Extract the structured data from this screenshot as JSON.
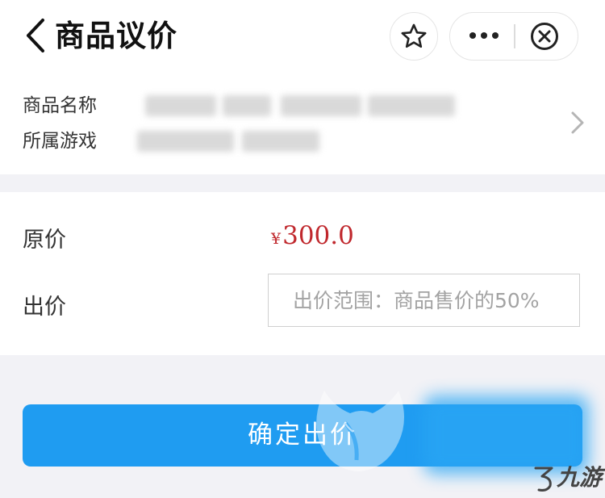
{
  "header": {
    "title": "商品议价"
  },
  "product": {
    "name_label": "商品名称",
    "game_label": "所属游戏"
  },
  "price": {
    "original_label": "原价",
    "currency_symbol": "¥",
    "original_value": "300.0",
    "offer_label": "出价",
    "offer_placeholder": "出价范围：商品售价的50%",
    "offer_value": ""
  },
  "confirm_button": {
    "label": "确定出价"
  },
  "watermark": {
    "brand_text": "九游"
  },
  "colors": {
    "primary_button": "#1f9cf1",
    "price_text": "#c0282d",
    "page_background": "#f2f2f6"
  }
}
